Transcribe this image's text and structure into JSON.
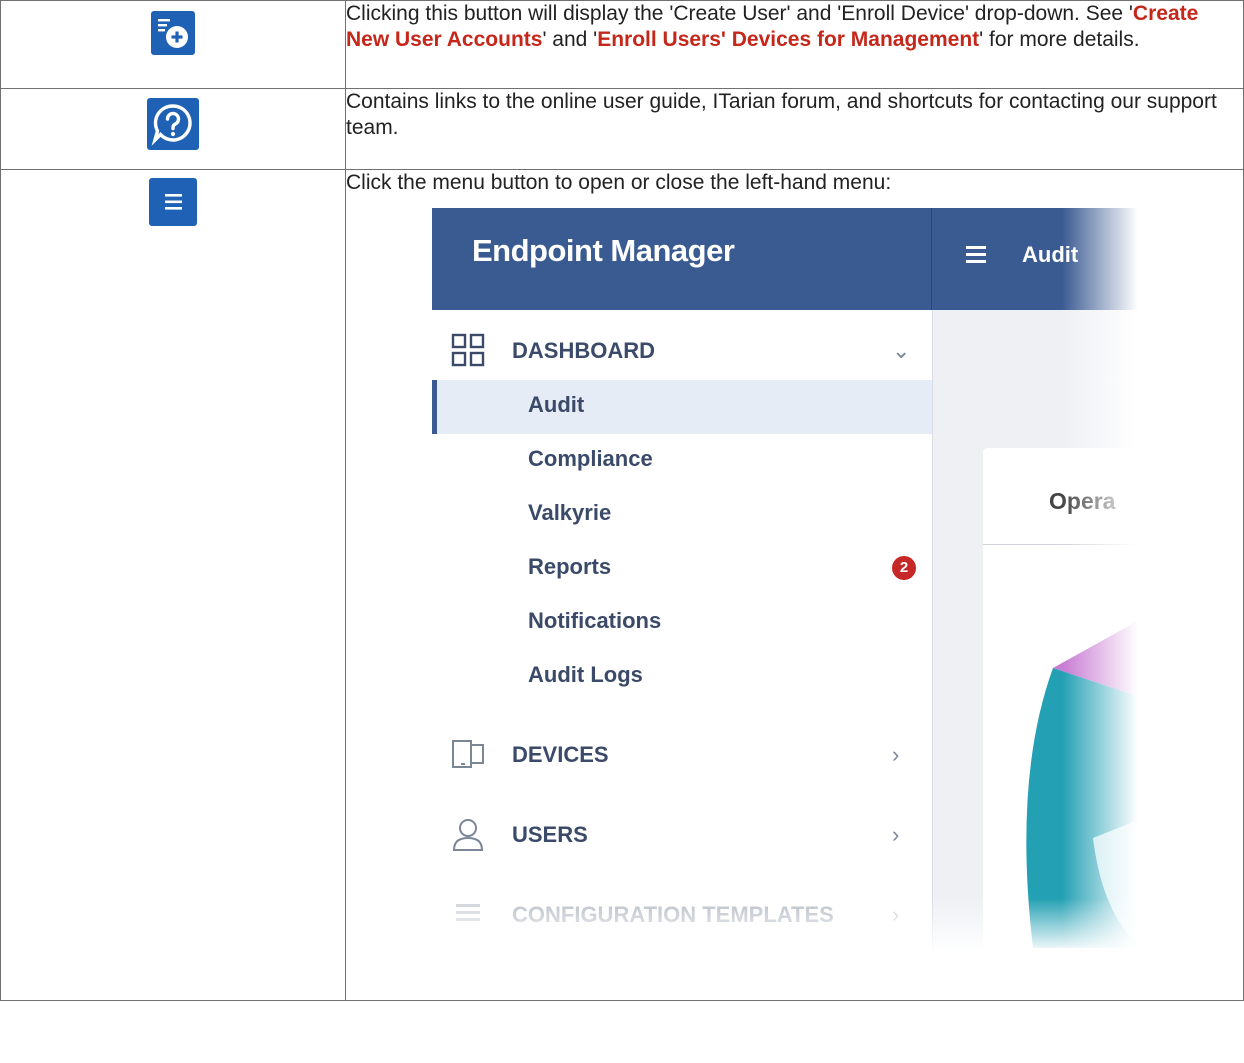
{
  "rows": [
    {
      "icon": "add-user-device-icon",
      "text_before": "Clicking this button will display the 'Create User' and 'Enroll Device' drop-down. See '",
      "link1": "Create New User Accounts",
      "text_mid": "' and '",
      "link2": "Enroll Users' Devices for Management",
      "text_after": "' for more details."
    },
    {
      "icon": "help-chat-icon",
      "text": "Contains links to the online user guide, ITarian forum, and shortcuts for contacting our support team."
    },
    {
      "icon": "menu-icon",
      "text": "Click the menu button to open or close the left-hand menu:"
    }
  ],
  "screenshot": {
    "brand": "Endpoint Manager",
    "breadcrumb": "Audit",
    "menu": {
      "dashboard": "DASHBOARD",
      "items": [
        "Audit",
        "Compliance",
        "Valkyrie",
        "Reports",
        "Notifications",
        "Audit Logs"
      ],
      "reports_badge": "2",
      "devices": "DEVICES",
      "users": "USERS",
      "config": "CONFIGURATION TEMPLATES"
    },
    "card_title": "Opera"
  },
  "colors": {
    "button_blue": "#1f62b5",
    "header_blue": "#3a5a92",
    "link_red": "#c5271a",
    "badge_red": "#c62828"
  }
}
